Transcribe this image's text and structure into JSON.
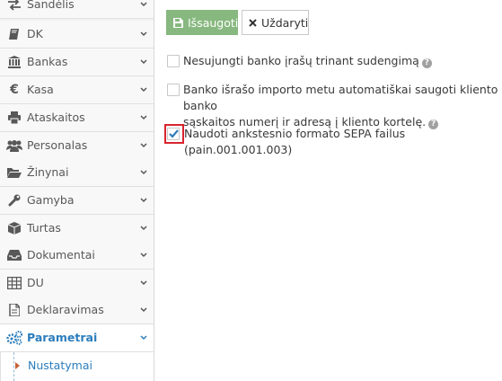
{
  "sidebar": {
    "items": [
      {
        "label": "Sandėlis",
        "icon": "exchange-arrows-icon"
      },
      {
        "label": "DK",
        "icon": "book-icon"
      },
      {
        "label": "Bankas",
        "icon": "bank-icon"
      },
      {
        "label": "Kasa",
        "icon": "euro-icon"
      },
      {
        "label": "Ataskaitos",
        "icon": "print-icon"
      },
      {
        "label": "Personalas",
        "icon": "users-icon"
      },
      {
        "label": "Žinynai",
        "icon": "folder-open-icon"
      },
      {
        "label": "Gamyba",
        "icon": "wrench-icon"
      },
      {
        "label": "Turtas",
        "icon": "cube-icon"
      },
      {
        "label": "Dokumentai",
        "icon": "inbox-icon"
      },
      {
        "label": "DU",
        "icon": "table-icon"
      },
      {
        "label": "Deklaravimas",
        "icon": "file-icon"
      },
      {
        "label": "Parametrai",
        "icon": "cogs-icon",
        "active": true
      }
    ],
    "sub_item": {
      "label": "Nustatymai"
    }
  },
  "toolbar": {
    "save_label": "Išsaugoti",
    "close_label": "Uždaryti"
  },
  "options": [
    {
      "label": "Nesujungti banko įrašų trinant sudengimą",
      "checked": false,
      "help": true
    },
    {
      "label_line1": "Banko išrašo importo metu automatiškai saugoti kliento banko",
      "label_line2": "sąskaitos numerį ir adresą į kliento kortelę.",
      "checked": false,
      "help": true
    },
    {
      "label": "Naudoti ankstesnio formato SEPA failus (pain.001.001.003)",
      "checked": true,
      "help": false
    }
  ],
  "colors": {
    "accent": "#2b7dbc",
    "save_button": "#87b87f",
    "highlight": "#d9232d",
    "check": "#2b7dbc"
  }
}
